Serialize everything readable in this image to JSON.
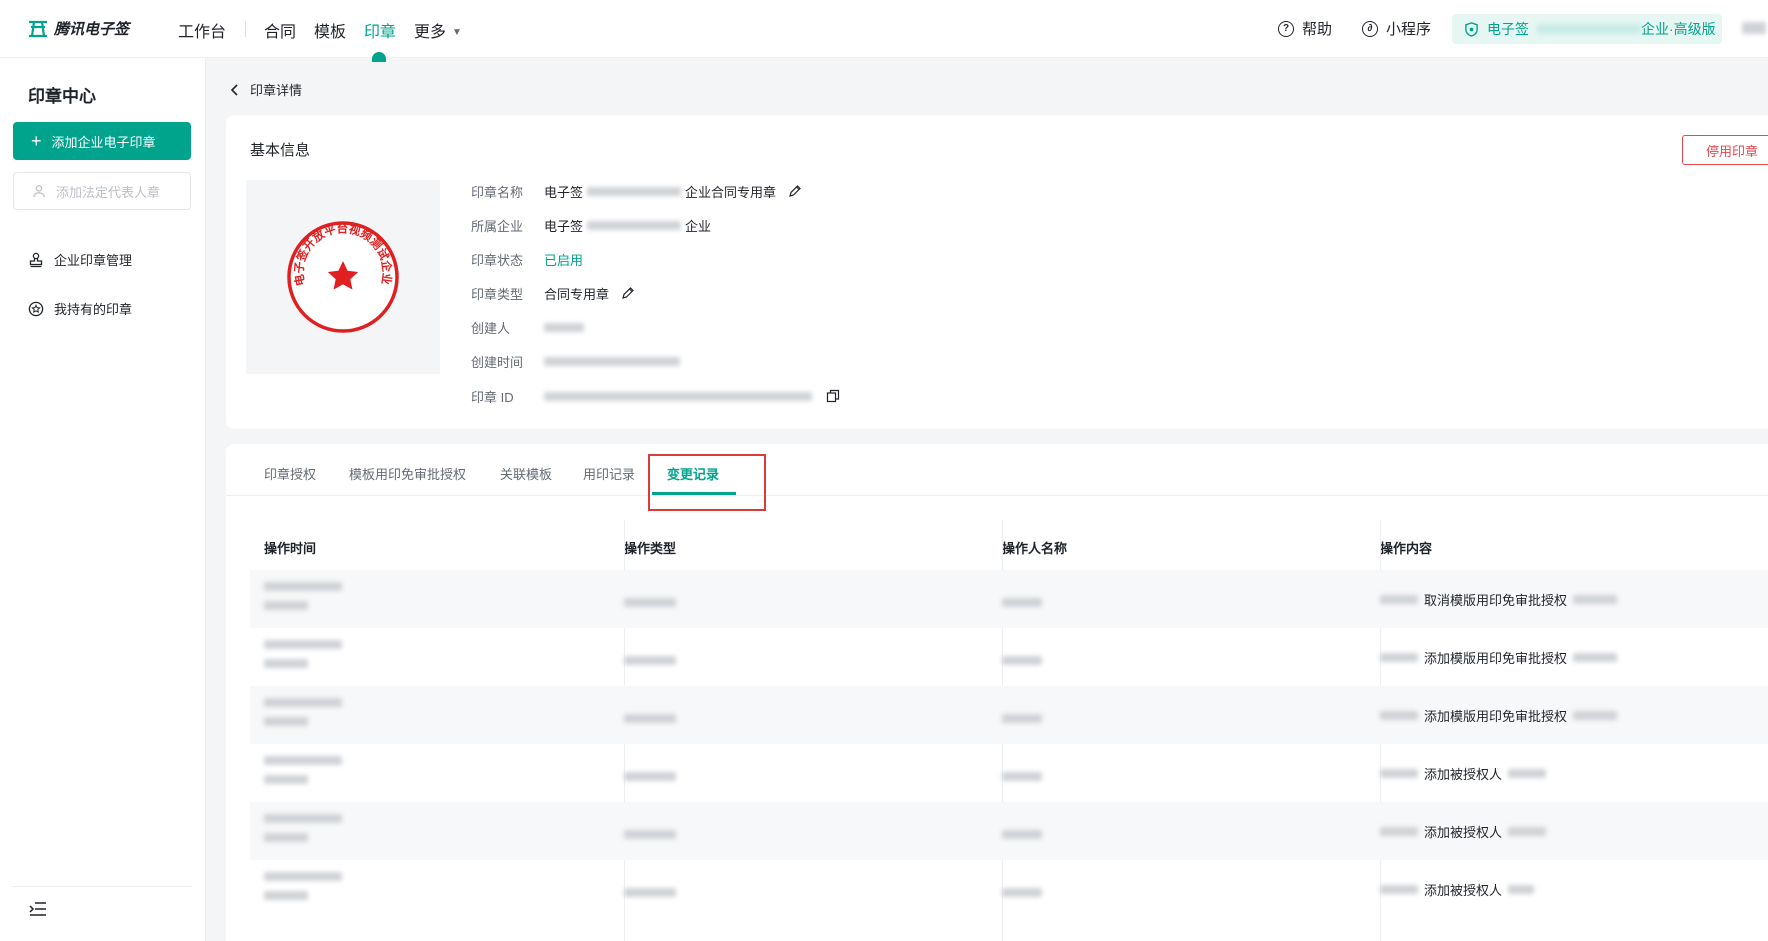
{
  "topnav": {
    "logo": "腾讯电子签",
    "items": [
      "工作台",
      "合同",
      "模板",
      "印章",
      "更多"
    ],
    "help": "帮助",
    "miniprogram": "小程序",
    "plan_prefix": "电子签",
    "plan_suffix": "企业·高级版"
  },
  "sidebar": {
    "title": "印章中心",
    "add_company_seal": "添加企业电子印章",
    "add_legal_seal": "添加法定代表人章",
    "menu": [
      "企业印章管理",
      "我持有的印章"
    ]
  },
  "detail": {
    "back_label": "印章详情",
    "section_title": "基本信息",
    "disable_button": "停用印章",
    "fields": {
      "name_label": "印章名称",
      "name_prefix": "电子签",
      "name_suffix": "企业合同专用章",
      "company_label": "所属企业",
      "company_prefix": "电子签",
      "company_suffix": "企业",
      "status_label": "印章状态",
      "status_value": "已启用",
      "type_label": "印章类型",
      "type_value": "合同专用章",
      "creator_label": "创建人",
      "created_label": "创建时间",
      "id_label": "印章 ID"
    },
    "seal_text": "电子签开放平台视频测试企业"
  },
  "tabs": {
    "items": [
      "印章授权",
      "模板用印免审批授权",
      "关联模板",
      "用印记录",
      "变更记录"
    ],
    "active": "变更记录"
  },
  "table": {
    "headers": [
      "操作时间",
      "操作类型",
      "操作人名称",
      "操作内容"
    ],
    "rows": [
      {
        "content": "取消模版用印免审批授权"
      },
      {
        "content": "添加模版用印免审批授权"
      },
      {
        "content": "添加模版用印免审批授权"
      },
      {
        "content": "添加被授权人"
      },
      {
        "content": "添加被授权人"
      },
      {
        "content": "添加被授权人"
      }
    ]
  },
  "colors": {
    "accent": "#00a38c",
    "danger": "#e5484d",
    "seal_red": "#e02020"
  }
}
